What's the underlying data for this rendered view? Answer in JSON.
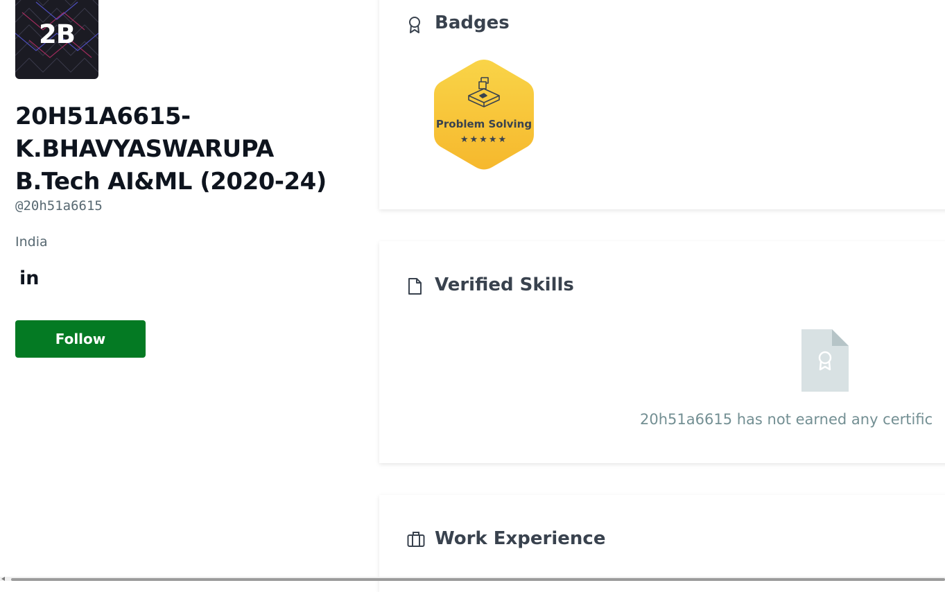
{
  "profile": {
    "avatar_initials": "2B",
    "name": "20H51A6615-K.BHAVYASWARUPA B.Tech AI&ML (2020-24)",
    "username": "@20h51a6615",
    "country": "India",
    "linkedin_label": "in",
    "follow_label": "Follow"
  },
  "badges": {
    "title": "Badges",
    "icon": "badge-ribbon-icon",
    "items": [
      {
        "label": "Problem Solving",
        "stars": "★★★★★",
        "star_count": 5,
        "color": "#f7c737"
      }
    ]
  },
  "verified_skills": {
    "title": "Verified Skills",
    "icon": "document-icon",
    "empty_message": "20h51a6615 has not earned any certific"
  },
  "work_experience": {
    "title": "Work Experience",
    "icon": "briefcase-icon"
  },
  "colors": {
    "follow_button": "#047a23",
    "heading": "#39424e",
    "muted": "#738f93",
    "badge_gold": "#f7c737"
  }
}
